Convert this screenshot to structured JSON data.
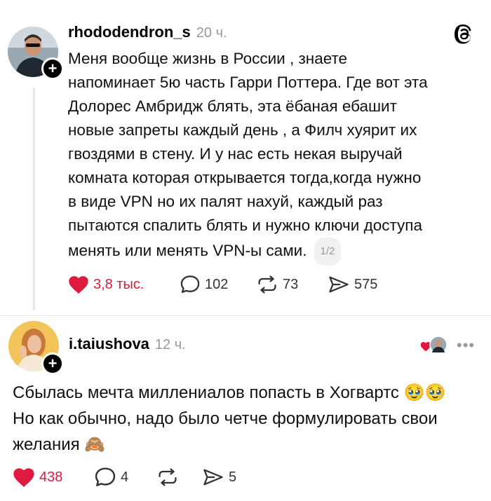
{
  "post": {
    "username": "rhododendron_s",
    "time": "20 ч.",
    "lines": [
      "Меня вообще жизнь в России , знаете",
      "напоминает 5ю часть Гарри Поттера. Где вот эта",
      "Долорес Амбридж блять, эта ёбаная ебашит",
      "новые запреты каждый день , а Филч хуярит их",
      "гвоздями в стену. И у нас есть некая  выручай",
      "комната которая открывается тогда,когда нужно",
      "в виде VPN но их палят нахуй, каждый раз",
      "пытаются спалить блять и нужно ключи доступа"
    ],
    "last_line": "менять или менять VPN-ы сами.",
    "page_badge": "1/2",
    "likes": "3,8 тыс.",
    "replies": "102",
    "reposts": "73",
    "shares": "575"
  },
  "reply": {
    "username": "i.taiushova",
    "time": "12 ч.",
    "lines": [
      "Сбылась мечта миллениалов попасть в Хогвартс 🥹🥹",
      "Но как обычно, надо было четче формулировать свои",
      "желания 🙈"
    ],
    "likes": "438",
    "replies": "4",
    "shares": "5"
  },
  "colors": {
    "like": "#e0193f",
    "muted": "#999999",
    "icon": "#333333"
  },
  "icons": [
    "threads-logo-icon",
    "plus-icon",
    "heart-icon",
    "comment-icon",
    "repost-icon",
    "share-icon",
    "more-icon"
  ]
}
